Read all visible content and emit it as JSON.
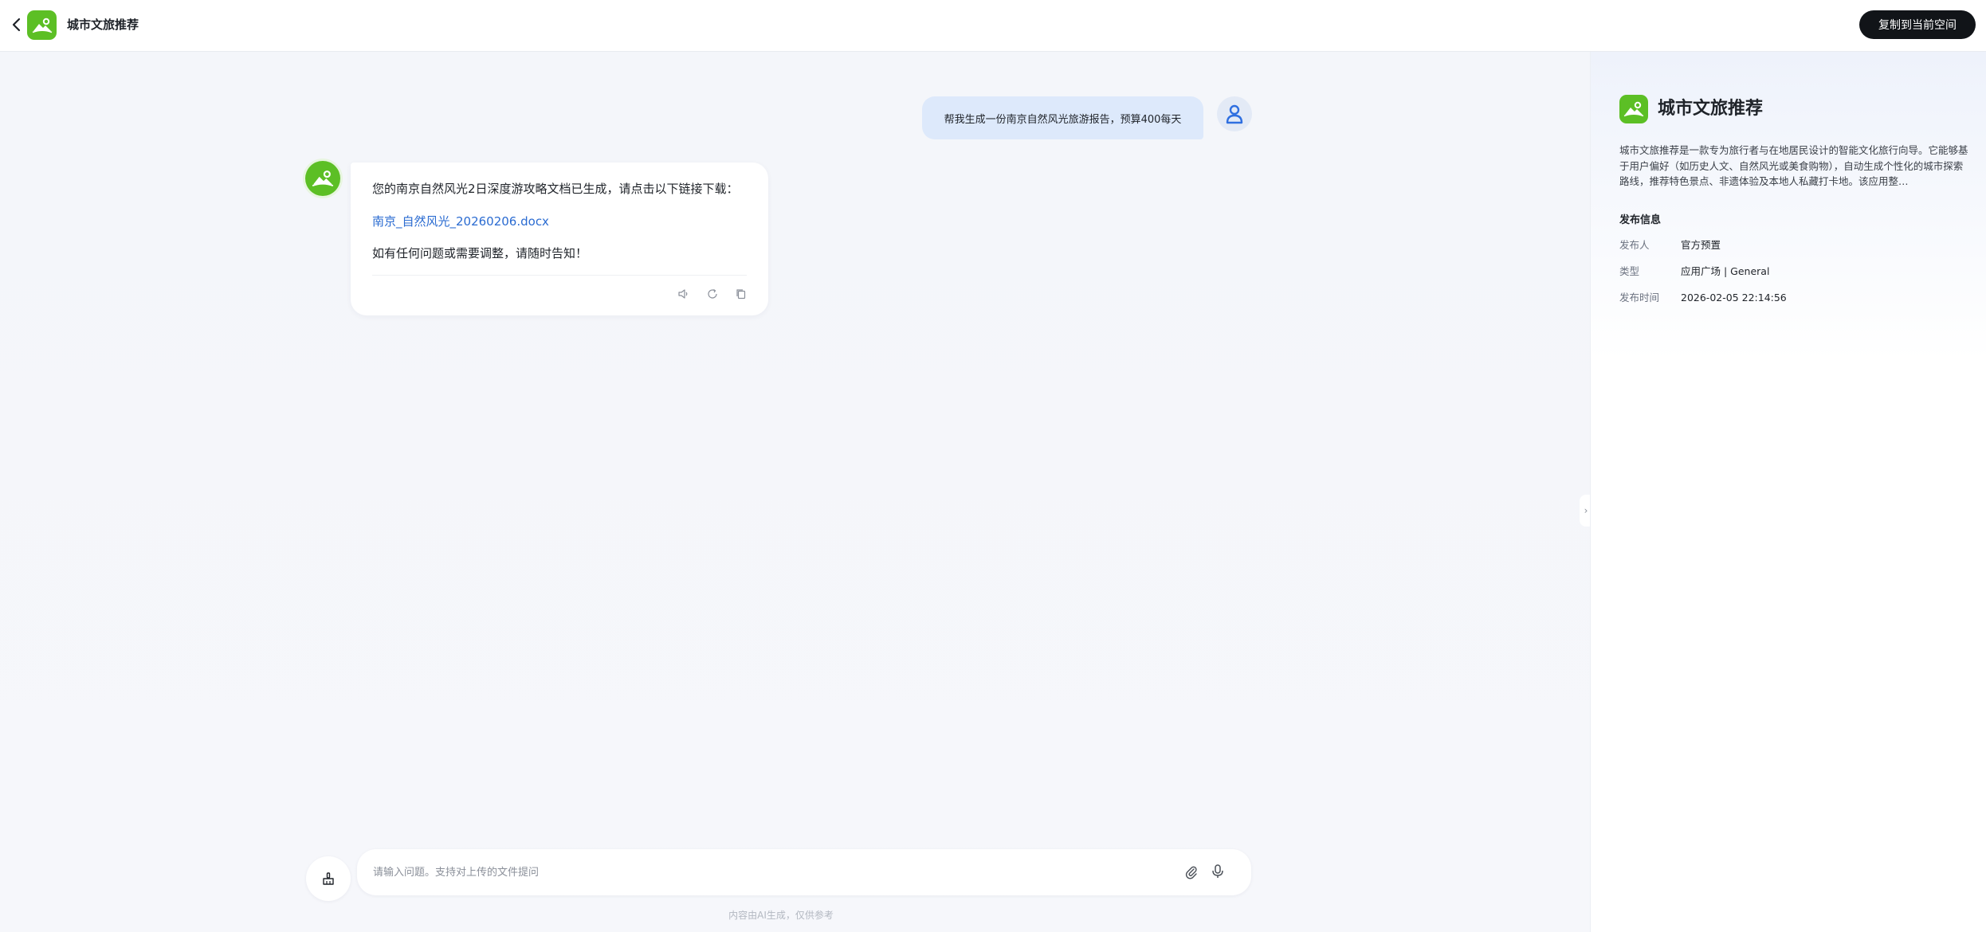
{
  "header": {
    "title": "城市文旅推荐",
    "copy_button": "复制到当前空间",
    "logo_icon": "mountain-landscape-icon",
    "accent_color": "#5cbf25"
  },
  "chat": {
    "user_message": "帮我生成一份南京自然风光旅游报告，预算400每天",
    "bot_message": {
      "line1": "您的南京自然风光2日深度游攻略文档已生成，请点击以下链接下载：",
      "link": "南京_自然风光_20260206.docx",
      "line3": "如有任何问题或需要调整，请随时告知！",
      "actions": [
        "speaker-icon",
        "regenerate-icon",
        "copy-icon"
      ]
    }
  },
  "input": {
    "placeholder": "请输入问题。支持对上传的文件提问",
    "value": ""
  },
  "disclaimer": "内容由AI生成，仅供参考",
  "panel": {
    "title": "城市文旅推荐",
    "description": "城市文旅推荐是一款专为旅行者与在地居民设计的智能文化旅行向导。它能够基于用户偏好（如历史人文、自然风光或美食购物），自动生成个性化的城市探索路线，推荐特色景点、非遗体验及本地人私藏打卡地。该应用整…",
    "publish_heading": "发布信息",
    "publisher_label": "发布人",
    "publisher_value": "官方预置",
    "type_label": "类型",
    "type_value": "应用广场 | General",
    "time_label": "发布时间",
    "time_value": "2026-02-05 22:14:56"
  }
}
